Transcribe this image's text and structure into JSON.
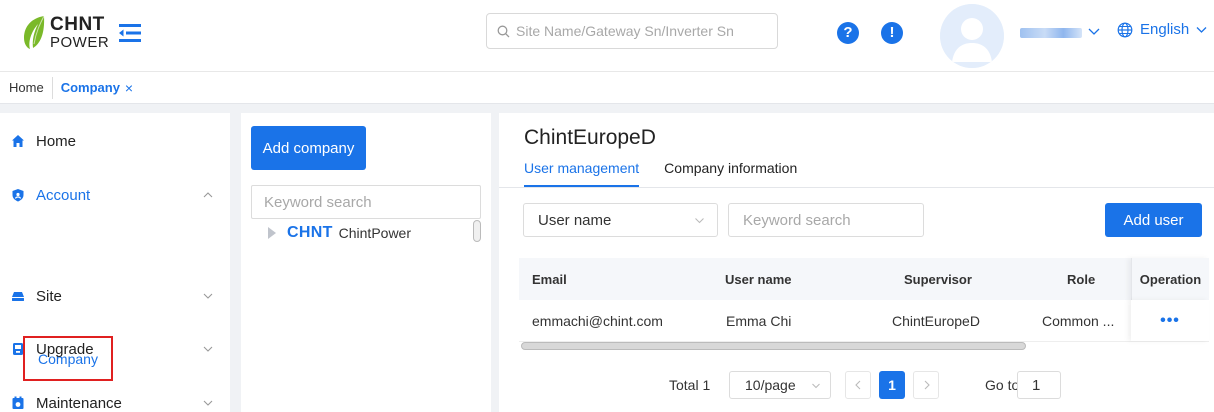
{
  "app": {
    "logo_line1": "CHNT",
    "logo_line2": "POWER",
    "search_placeholder": "Site Name/Gateway Sn/Inverter Sn",
    "help_glyph": "?",
    "alert_glyph": "!",
    "language": "English",
    "brand_color": "#1a73e8"
  },
  "tabs": {
    "home": "Home",
    "company": "Company",
    "close_glyph": "×"
  },
  "sidebar": {
    "items": [
      {
        "label": "Home",
        "icon": "home-icon",
        "expanded": null
      },
      {
        "label": "Account",
        "icon": "shield-icon",
        "expanded": true
      },
      {
        "label": "Site",
        "icon": "site-icon",
        "expanded": false
      },
      {
        "label": "Upgrade",
        "icon": "upgrade-icon",
        "expanded": false
      },
      {
        "label": "Maintenance",
        "icon": "maintenance-icon",
        "expanded": false
      }
    ],
    "sub_company": "Company"
  },
  "company_panel": {
    "add_button": "Add company",
    "search_placeholder": "Keyword search",
    "tree": [
      {
        "brand": "CHNT",
        "name": "ChintPower"
      }
    ]
  },
  "detail": {
    "title": "ChintEuropeD",
    "tabs": {
      "user_management": "User management",
      "company_information": "Company information"
    },
    "filter_select": "User name",
    "search_placeholder": "Keyword search",
    "add_user": "Add user",
    "columns": {
      "email": "Email",
      "user_name": "User name",
      "supervisor": "Supervisor",
      "role": "Role",
      "operation": "Operation"
    },
    "rows": [
      {
        "email": "emmachi@chint.com",
        "user_name": "Emma Chi",
        "supervisor": "ChintEuropeD",
        "role": "Common ...",
        "operation": "•••"
      }
    ],
    "pagination": {
      "total": "Total 1",
      "page_size": "10/page",
      "current_page": "1",
      "goto_label": "Go to",
      "goto_value": "1"
    }
  }
}
